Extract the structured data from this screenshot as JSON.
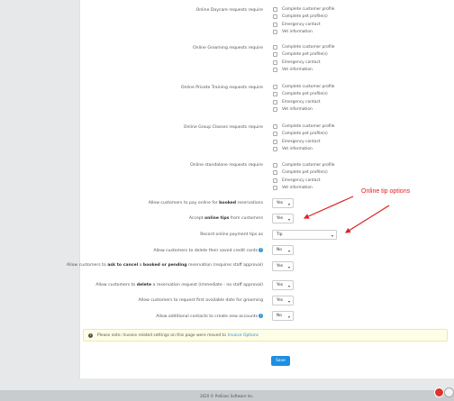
{
  "requirement_groups": [
    {
      "label": "Online Daycare requests require",
      "options": [
        "Complete customer profile",
        "Complete pet profile(s)",
        "Emergency contact",
        "Vet information"
      ]
    },
    {
      "label": "Online Grooming requests require",
      "options": [
        "Complete customer profile",
        "Complete pet profile(s)",
        "Emergency contact",
        "Vet information"
      ]
    },
    {
      "label": "Online Private Training requests require",
      "options": [
        "Complete customer profile",
        "Complete pet profile(s)",
        "Emergency contact",
        "Vet information"
      ]
    },
    {
      "label": "Online Group Classes requests require",
      "options": [
        "Complete customer profile",
        "Complete pet profile(s)",
        "Emergency contact",
        "Vet information"
      ]
    },
    {
      "label": "Online standalone requests require",
      "options": [
        "Complete customer profile",
        "Complete pet profile(s)",
        "Emergency contact",
        "Vet information"
      ]
    }
  ],
  "settings": {
    "pay_booked": {
      "pre": "Allow customers to pay online for ",
      "bold": "booked",
      "post": " reservations",
      "value": "Yes"
    },
    "accept_tips": {
      "pre": "Accept ",
      "bold": "online tips",
      "post": " from customers",
      "value": "Yes"
    },
    "payment_tip_as": {
      "label": "Record online payment tips as",
      "value": "Tip"
    },
    "delete_cards": {
      "label": "Allow customers to delete their saved credit cards",
      "value": "No"
    },
    "ask_cancel": {
      "pre": "Allow customers to ",
      "bold1": "ask to cancel",
      "mid": " a ",
      "bold2": "booked or pending",
      "post": " reservation (requires staff approval)",
      "value": "Yes"
    },
    "delete_request": {
      "pre": "Allow customers to ",
      "bold": "delete",
      "post": " a reservation request (immediate - no staff approval)",
      "value": "Yes"
    },
    "first_available": {
      "label": "Allow customers to request first available date for grooming",
      "value": "Yes"
    },
    "additional_contacts": {
      "label": "Allow additional contacts to create new accounts",
      "value": "No"
    }
  },
  "note": {
    "text": "Please note: Invoice related settings on this page were moved to",
    "link": "Invoice Options"
  },
  "save_label": "Save",
  "annotation": "Online tip options",
  "footer": "2020 © PetExec Software Inc.",
  "colors": {
    "accent": "#1d8fe1",
    "annotation": "#e02020",
    "note_bg": "#fefde6"
  }
}
